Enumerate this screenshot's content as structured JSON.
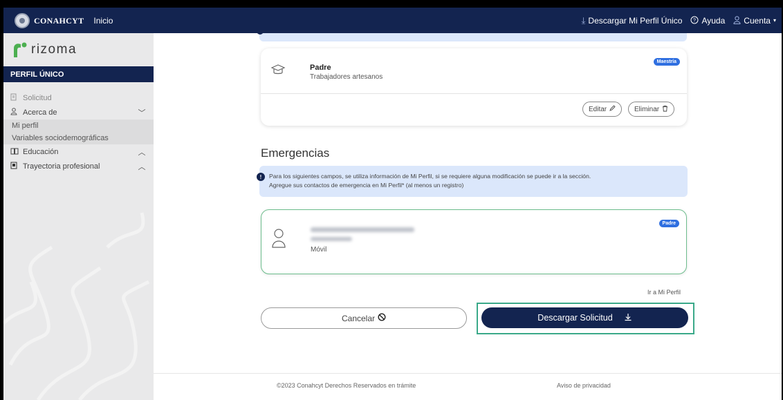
{
  "topbar": {
    "brand": "CONAHCYT",
    "home": "Inicio",
    "download_profile": "Descargar Mi Perfil Único",
    "help": "Ayuda",
    "account": "Cuenta",
    "icons": [
      "download-icon",
      "help-circle-icon",
      "user-icon",
      "caret-down-icon"
    ]
  },
  "sidebar": {
    "logo_text": "rizoma",
    "section_header": "PERFIL ÚNICO",
    "items": [
      {
        "label": "Solicitud",
        "icon": "edit-doc-icon"
      },
      {
        "label": "Acerca de",
        "icon": "user-icon",
        "expanded": true
      },
      {
        "label": "Mi perfil"
      },
      {
        "label": "Variables sociodemográficas"
      },
      {
        "label": "Educación",
        "icon": "book-icon",
        "expanded": false
      },
      {
        "label": "Trayectoria profesional",
        "icon": "badge-icon",
        "expanded": false
      }
    ]
  },
  "padre_card": {
    "title": "Padre",
    "subtitle": "Trabajadores artesanos",
    "badge": "Maestría",
    "edit_label": "Editar",
    "delete_label": "Eliminar"
  },
  "emergencias": {
    "title": "Emergencias",
    "info_line1": "Para los siguientes campos, se utiliza información de Mi Perfil, si se requiere alguna modificación se puede ir a la sección.",
    "info_line2": "Agregue sus contactos de emergencia en Mi Perfil* (al menos un registro)",
    "contact": {
      "badge": "Padre",
      "phone_type": "Móvil"
    },
    "go_profile": "Ir a Mi Perfil"
  },
  "actions": {
    "cancel": "Cancelar",
    "download": "Descargar Solicitud"
  },
  "footer": {
    "copyright": "©2023 Conahcyt Derechos Reservados en trámite",
    "privacy": "Aviso de privacidad"
  },
  "colors": {
    "navy": "#132450",
    "info_bg": "#dbe7fb",
    "badge_blue": "#2f6fe0",
    "highlight_green": "#3aa989"
  }
}
